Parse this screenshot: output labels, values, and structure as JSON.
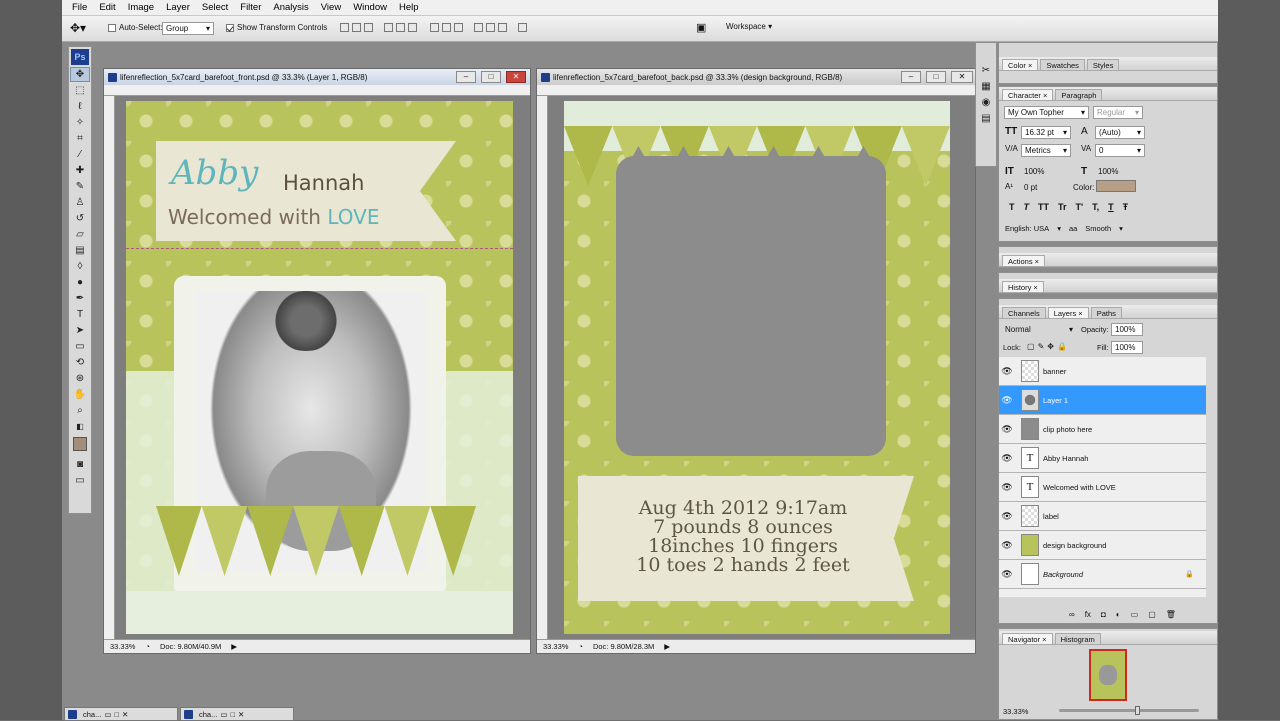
{
  "menu": [
    "File",
    "Edit",
    "Image",
    "Layer",
    "Select",
    "Filter",
    "Analysis",
    "View",
    "Window",
    "Help"
  ],
  "options": {
    "auto_select_label": "Auto-Select:",
    "auto_select_value": "Group",
    "transform_label": "Show Transform Controls",
    "workspace_label": "Workspace ▾"
  },
  "ps_logo": "Ps",
  "doc_front": {
    "title": "lifenreflection_5x7card_barefoot_front.psd @ 33.3% (Layer 1, RGB/8)",
    "zoom": "33.33%",
    "doc_size": "Doc: 9.80M/40.9M",
    "name_first": "Abby",
    "name_last": "Hannah",
    "tagline_a": "Welcomed with",
    "tagline_b": "LOVE"
  },
  "doc_back": {
    "title": "lifenreflection_5x7card_barefoot_back.psd @ 33.3% (design background, RGB/8)",
    "zoom": "33.33%",
    "doc_size": "Doc: 9.80M/28.3M",
    "lines": [
      "Aug 4th 2012 9:17am",
      "7 pounds 8 ounces",
      "18inches 10 fingers",
      "10 toes 2 hands 2 feet"
    ]
  },
  "panels": {
    "color_tabs": [
      "Color ×",
      "Swatches",
      "Styles"
    ],
    "char_tabs": [
      "Character ×",
      "Paragraph"
    ],
    "font_family": "My Own Topher",
    "font_style": "Regular",
    "font_size": "16.32 pt",
    "leading": "(Auto)",
    "kerning": "Metrics",
    "tracking": "0",
    "v_scale": "100%",
    "h_scale": "100%",
    "baseline": "0 pt",
    "color_label": "Color:",
    "text_color": "#b79f86",
    "type_buttons": [
      "T",
      "T",
      "TT",
      "Tr",
      "T'",
      "T,",
      "T",
      "Ŧ"
    ],
    "language": "English: USA",
    "aa": "aa",
    "smooth": "Smooth",
    "actions_tab": "Actions ×",
    "history_tab": "History ×",
    "layer_tabs": [
      "Channels",
      "Layers ×",
      "Paths"
    ],
    "blend_mode": "Normal",
    "opacity_label": "Opacity:",
    "opacity": "100%",
    "lock_label": "Lock:",
    "fill_label": "Fill:",
    "fill": "100%",
    "layers": [
      {
        "name": "banner",
        "type": "pattern",
        "selected": false,
        "link": false
      },
      {
        "name": "Layer 1",
        "type": "photo",
        "selected": true,
        "link": true
      },
      {
        "name": "clip photo here",
        "type": "gray",
        "selected": false,
        "link": false
      },
      {
        "name": "Abby Hannah",
        "type": "text",
        "selected": false,
        "link": false
      },
      {
        "name": "Welcomed with LOVE",
        "type": "text",
        "selected": false,
        "link": false
      },
      {
        "name": "label",
        "type": "pattern",
        "selected": false,
        "link": false
      },
      {
        "name": "design background",
        "type": "green",
        "selected": false,
        "link": false
      },
      {
        "name": "Background",
        "type": "white",
        "selected": false,
        "link": false
      }
    ],
    "layer_footer": [
      "∞",
      "fx",
      "◘",
      "◐",
      "▭",
      "▢",
      "🗑"
    ],
    "nav_tabs": [
      "Navigator ×",
      "Histogram"
    ],
    "nav_zoom": "33.33%"
  },
  "taskbar": [
    {
      "label": "cha..."
    },
    {
      "label": "cha..."
    }
  ]
}
